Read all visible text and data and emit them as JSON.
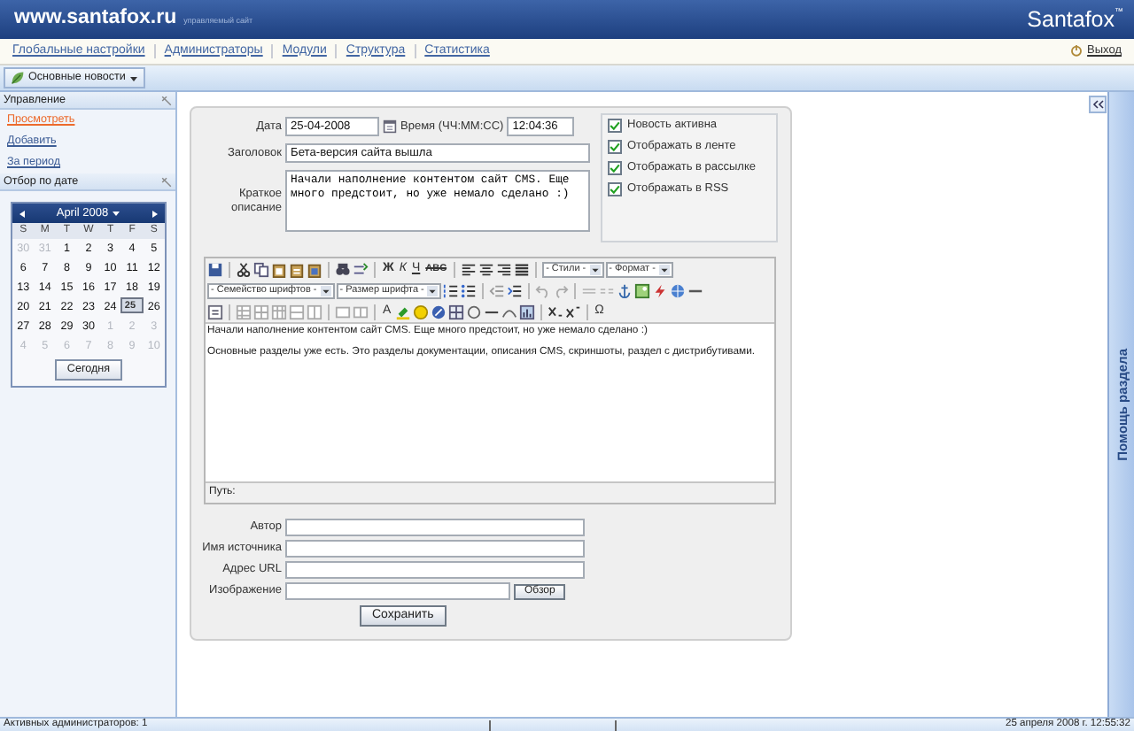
{
  "header": {
    "site": "www.santafox.ru",
    "tagline": "управляемый сайт",
    "brand": "Santafox",
    "trademark": "™"
  },
  "menu": {
    "items": [
      {
        "label": "Глобальные настройки"
      },
      {
        "label": "Администраторы"
      },
      {
        "label": "Модули"
      },
      {
        "label": "Структура"
      },
      {
        "label": "Статистика"
      }
    ],
    "logout": "Выход"
  },
  "toolbar": {
    "module_button": "Основные новости"
  },
  "sidebar": {
    "management": {
      "title": "Управление",
      "items": [
        {
          "label": "Просмотреть",
          "selected": true
        },
        {
          "label": "Добавить",
          "selected": false
        },
        {
          "label": "За период",
          "selected": false
        }
      ]
    },
    "date_filter": {
      "title": "Отбор по дате",
      "calendar": {
        "month": "April 2008",
        "weekdays": [
          "S",
          "M",
          "T",
          "W",
          "T",
          "F",
          "S"
        ],
        "weeks": [
          [
            {
              "day": "30",
              "muted": true,
              "selected": false
            },
            {
              "day": "31",
              "muted": true,
              "selected": false
            },
            {
              "day": "1",
              "muted": false,
              "selected": false
            },
            {
              "day": "2",
              "muted": false,
              "selected": false
            },
            {
              "day": "3",
              "muted": false,
              "selected": false
            },
            {
              "day": "4",
              "muted": false,
              "selected": false
            },
            {
              "day": "5",
              "muted": false,
              "selected": false
            }
          ],
          [
            {
              "day": "6",
              "muted": false,
              "selected": false
            },
            {
              "day": "7",
              "muted": false,
              "selected": false
            },
            {
              "day": "8",
              "muted": false,
              "selected": false
            },
            {
              "day": "9",
              "muted": false,
              "selected": false
            },
            {
              "day": "10",
              "muted": false,
              "selected": false
            },
            {
              "day": "11",
              "muted": false,
              "selected": false
            },
            {
              "day": "12",
              "muted": false,
              "selected": false
            }
          ],
          [
            {
              "day": "13",
              "muted": false,
              "selected": false
            },
            {
              "day": "14",
              "muted": false,
              "selected": false
            },
            {
              "day": "15",
              "muted": false,
              "selected": false
            },
            {
              "day": "16",
              "muted": false,
              "selected": false
            },
            {
              "day": "17",
              "muted": false,
              "selected": false
            },
            {
              "day": "18",
              "muted": false,
              "selected": false
            },
            {
              "day": "19",
              "muted": false,
              "selected": false
            }
          ],
          [
            {
              "day": "20",
              "muted": false,
              "selected": false
            },
            {
              "day": "21",
              "muted": false,
              "selected": false
            },
            {
              "day": "22",
              "muted": false,
              "selected": false
            },
            {
              "day": "23",
              "muted": false,
              "selected": false
            },
            {
              "day": "24",
              "muted": false,
              "selected": false
            },
            {
              "day": "25",
              "muted": false,
              "selected": true
            },
            {
              "day": "26",
              "muted": false,
              "selected": false
            }
          ],
          [
            {
              "day": "27",
              "muted": false,
              "selected": false
            },
            {
              "day": "28",
              "muted": false,
              "selected": false
            },
            {
              "day": "29",
              "muted": false,
              "selected": false
            },
            {
              "day": "30",
              "muted": false,
              "selected": false
            },
            {
              "day": "1",
              "muted": true,
              "selected": false
            },
            {
              "day": "2",
              "muted": true,
              "selected": false
            },
            {
              "day": "3",
              "muted": true,
              "selected": false
            }
          ],
          [
            {
              "day": "4",
              "muted": true,
              "selected": false
            },
            {
              "day": "5",
              "muted": true,
              "selected": false
            },
            {
              "day": "6",
              "muted": true,
              "selected": false
            },
            {
              "day": "7",
              "muted": true,
              "selected": false
            },
            {
              "day": "8",
              "muted": true,
              "selected": false
            },
            {
              "day": "9",
              "muted": true,
              "selected": false
            },
            {
              "day": "10",
              "muted": true,
              "selected": false
            }
          ]
        ],
        "today_button": "Сегодня"
      }
    }
  },
  "form": {
    "date": {
      "label": "Дата",
      "value": "25-04-2008"
    },
    "time": {
      "label": "Время (ЧЧ:ММ:СС)",
      "value": "12:04:36"
    },
    "title": {
      "label": "Заголовок",
      "value": "Бета-версия сайта вышла"
    },
    "summary": {
      "label": "Краткое описание",
      "value": "Начали наполнение контентом сайт CMS. Еще много предстоит, но уже немало сделано :)"
    },
    "options": [
      {
        "label": "Новость активна",
        "checked": true
      },
      {
        "label": "Отображать в ленте",
        "checked": true
      },
      {
        "label": "Отображать в рассылке",
        "checked": true
      },
      {
        "label": "Отображать в RSS",
        "checked": true
      }
    ],
    "editor": {
      "toolbar_rows": [
        [
          {
            "kind": "icon"
          },
          {
            "kind": "sep"
          },
          {
            "kind": "icon"
          },
          {
            "kind": "icon"
          },
          {
            "kind": "icon"
          },
          {
            "kind": "icon"
          },
          {
            "kind": "icon"
          },
          {
            "kind": "sep"
          },
          {
            "kind": "icon"
          },
          {
            "kind": "icon"
          },
          {
            "kind": "sep"
          },
          {
            "kind": "glyph",
            "text": "Ж"
          },
          {
            "kind": "glyph",
            "text": "К"
          },
          {
            "kind": "glyph",
            "text": "Ч"
          },
          {
            "kind": "glyph",
            "text": "ABC"
          },
          {
            "kind": "sep"
          },
          {
            "kind": "icon"
          },
          {
            "kind": "icon"
          },
          {
            "kind": "icon"
          },
          {
            "kind": "icon"
          },
          {
            "kind": "sep"
          },
          {
            "kind": "select",
            "text": "- Стили -"
          },
          {
            "kind": "select",
            "text": "- Формат -"
          }
        ],
        [
          {
            "kind": "select",
            "text": "- Семейство шрифтов -"
          },
          {
            "kind": "select",
            "text": "- Размер шрифта -"
          },
          {
            "kind": "icon"
          },
          {
            "kind": "icon"
          },
          {
            "kind": "sep"
          },
          {
            "kind": "icon"
          },
          {
            "kind": "icon"
          },
          {
            "kind": "sep"
          },
          {
            "kind": "icon"
          },
          {
            "kind": "icon"
          },
          {
            "kind": "sep"
          },
          {
            "kind": "icon"
          },
          {
            "kind": "icon"
          },
          {
            "kind": "icon"
          },
          {
            "kind": "icon"
          },
          {
            "kind": "icon"
          },
          {
            "kind": "icon"
          },
          {
            "kind": "icon"
          }
        ],
        [
          {
            "kind": "icon"
          },
          {
            "kind": "sep"
          },
          {
            "kind": "icon"
          },
          {
            "kind": "icon"
          },
          {
            "kind": "icon"
          },
          {
            "kind": "icon"
          },
          {
            "kind": "icon"
          },
          {
            "kind": "sep"
          },
          {
            "kind": "icon"
          },
          {
            "kind": "icon"
          },
          {
            "kind": "sep"
          },
          {
            "kind": "glyph",
            "text": "A"
          },
          {
            "kind": "icon"
          },
          {
            "kind": "icon"
          },
          {
            "kind": "icon"
          },
          {
            "kind": "icon"
          },
          {
            "kind": "icon"
          },
          {
            "kind": "icon"
          },
          {
            "kind": "icon"
          },
          {
            "kind": "icon"
          },
          {
            "kind": "sep"
          },
          {
            "kind": "icon"
          },
          {
            "kind": "icon"
          },
          {
            "kind": "sep"
          },
          {
            "kind": "glyph",
            "text": "Ω"
          }
        ]
      ],
      "paragraphs": [
        "Начали наполнение контентом сайт CMS. Еще много предстоит, но уже немало сделано :)",
        "Основные разделы уже есть. Это разделы документации, описания CMS, скриншоты, раздел с дистрибутивами."
      ],
      "path_label": "Путь:"
    },
    "fields": [
      {
        "label": "Автор",
        "kind": "text"
      },
      {
        "label": "Имя источника",
        "kind": "text"
      },
      {
        "label": "Адрес URL",
        "kind": "text"
      },
      {
        "label": "Изображение",
        "kind": "file",
        "browse_button": "Обзор"
      }
    ],
    "save_button": "Сохранить"
  },
  "help_tab": "Помощь раздела",
  "status_bar": {
    "admins_label": "Активных администраторов:",
    "admins_count": "1",
    "datetime": "25 апреля 2008 г. 12:55:32"
  }
}
